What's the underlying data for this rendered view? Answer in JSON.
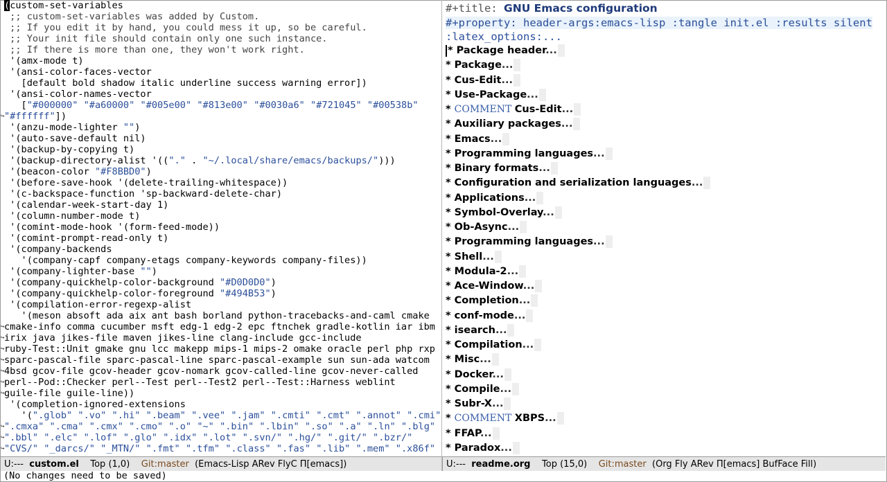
{
  "left_buffer": {
    "lines": [
      "(custom-set-variables",
      " ;; custom-set-variables was added by Custom.",
      " ;; If you edit it by hand, you could mess it up, so be careful.",
      " ;; Your init file should contain only one such instance.",
      " ;; If there is more than one, they won't work right.",
      " '(amx-mode t)",
      " '(ansi-color-faces-vector",
      "   [default bold shadow italic underline success warning error])",
      " '(ansi-color-names-vector",
      "   [\"#000000\" \"#a60000\" \"#005e00\" \"#813e00\" \"#0030a6\" \"#721045\" \"#00538b\"",
      "\"#ffffff\"])",
      " '(anzu-mode-lighter \"\")",
      " '(auto-save-default nil)",
      " '(backup-by-copying t)",
      " '(backup-directory-alist '((\".\" . \"~/.local/share/emacs/backups/\")))",
      " '(beacon-color \"#F8BBD0\")",
      " '(before-save-hook '(delete-trailing-whitespace))",
      " '(c-backspace-function 'sp-backward-delete-char)",
      " '(calendar-week-start-day 1)",
      " '(column-number-mode t)",
      " '(comint-mode-hook '(form-feed-mode))",
      " '(comint-prompt-read-only t)",
      " '(company-backends",
      "   '(company-capf company-etags company-keywords company-files))",
      " '(company-lighter-base \"\")",
      " '(company-quickhelp-color-background \"#D0D0D0\")",
      " '(company-quickhelp-color-foreground \"#494B53\")",
      " '(compilation-error-regexp-alist",
      "   '(meson absoft ada aix ant bash borland python-tracebacks-and-caml cmake",
      "cmake-info comma cucumber msft edg-1 edg-2 epc ftnchek gradle-kotlin iar ibm",
      "irix java jikes-file maven jikes-line clang-include gcc-include",
      "ruby-Test::Unit gmake gnu lcc makepp mips-1 mips-2 omake oracle perl php rxp",
      "sparc-pascal-file sparc-pascal-line sparc-pascal-example sun sun-ada watcom",
      "4bsd gcov-file gcov-header gcov-nomark gcov-called-line gcov-never-called",
      "perl--Pod::Checker perl--Test perl--Test2 perl--Test::Harness weblint",
      "guile-file guile-line))",
      " '(completion-ignored-extensions",
      "   '(\".glob\" \".vo\" \".hi\" \".beam\" \".vee\" \".jam\" \".cmti\" \".cmt\" \".annot\" \".cmi\"",
      "\".cmxa\" \".cma\" \".cmx\" \".cmo\" \".o\" \"~\" \".bin\" \".lbin\" \".so\" \".a\" \".ln\" \".blg\"",
      "\".bbl\" \".elc\" \".lof\" \".glo\" \".idx\" \".lot\" \".svn/\" \".hg/\" \".git/\" \".bzr/\"",
      "\"CVS/\" \"_darcs/\" \"_MTN/\" \".fmt\" \".tfm\" \".class\" \".fas\" \".lib\" \".mem\" \".x86f\""
    ]
  },
  "right_buffer": {
    "title_keyword": "#+title:",
    "title_value": "GNU Emacs configuration",
    "property_line": "#+property: header-args:emacs-lisp :tangle init.el :results silent",
    "property_cont": ":latex_options:...",
    "headings": [
      {
        "text": "Package header",
        "comment": false
      },
      {
        "text": "Package",
        "comment": false
      },
      {
        "text": "Cus-Edit",
        "comment": false
      },
      {
        "text": "Use-Package",
        "comment": false
      },
      {
        "text": "Cus-Edit",
        "comment": true
      },
      {
        "text": "Auxiliary packages",
        "comment": false
      },
      {
        "text": "Emacs",
        "comment": false
      },
      {
        "text": "Programming languages",
        "comment": false
      },
      {
        "text": "Binary formats",
        "comment": false
      },
      {
        "text": "Configuration and serialization languages",
        "comment": false
      },
      {
        "text": "Applications",
        "comment": false
      },
      {
        "text": "Symbol-Overlay",
        "comment": false
      },
      {
        "text": "Ob-Async",
        "comment": false
      },
      {
        "text": "Programming languages",
        "comment": false
      },
      {
        "text": "Shell",
        "comment": false
      },
      {
        "text": "Modula-2",
        "comment": false
      },
      {
        "text": "Ace-Window",
        "comment": false
      },
      {
        "text": "Completion",
        "comment": false
      },
      {
        "text": "conf-mode",
        "comment": false
      },
      {
        "text": "isearch",
        "comment": false
      },
      {
        "text": "Compilation",
        "comment": false
      },
      {
        "text": "Misc",
        "comment": false
      },
      {
        "text": "Docker",
        "comment": false
      },
      {
        "text": "Compile",
        "comment": false
      },
      {
        "text": "Subr-X",
        "comment": false
      },
      {
        "text": "XBPS",
        "comment": true
      },
      {
        "text": "FFAP",
        "comment": false
      },
      {
        "text": "Paradox",
        "comment": false
      }
    ],
    "comment_keyword": "COMMENT",
    "ellipsis": "...",
    "star": "*"
  },
  "modeline_left": {
    "state": "U:---",
    "buffer": "custom.el",
    "position": "Top (1,0)",
    "vc": "Git:master",
    "modes": "(Emacs-Lisp ARev FlyC Π[emacs])"
  },
  "modeline_right": {
    "state": "U:---",
    "buffer": "readme.org",
    "position": "Top (15,0)",
    "vc": "Git:master",
    "modes": "(Org Fly ARev Π[emacs] BufFace Fill)"
  },
  "minibuffer": "(No changes need to be saved)",
  "colors": {
    "string": "#2b4f9a",
    "modeline_bg": "#e5e5e5",
    "heading_fg": "#000000",
    "comment_kw": "#3a5ea8"
  }
}
